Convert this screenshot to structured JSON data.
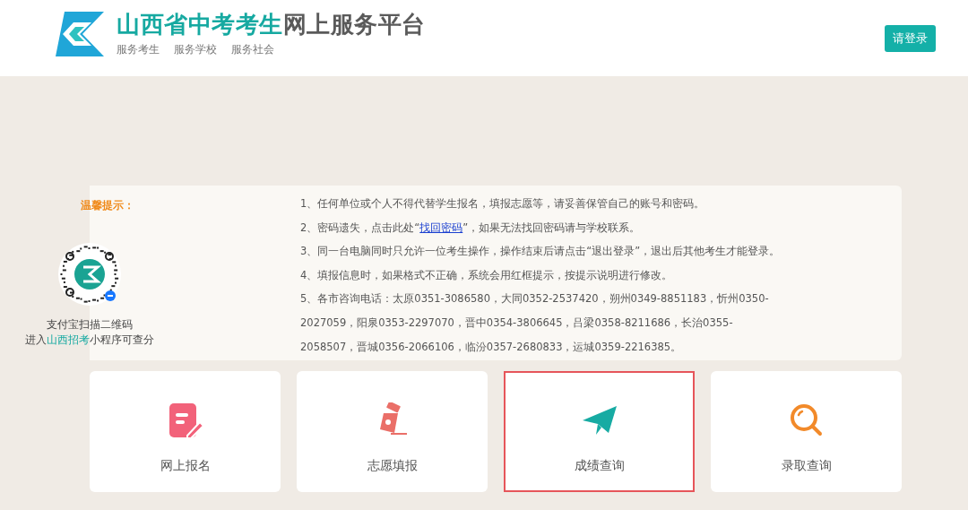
{
  "header": {
    "title_highlight": "山西省中考考生",
    "title_rest": "网上服务平台",
    "subtitle_links": [
      "服务考生",
      "服务学校",
      "服务社会"
    ],
    "login_button": "请登录"
  },
  "notice": {
    "heading": "温馨提示：",
    "qr_caption_line1": "支付宝扫描二维码",
    "qr_caption_line2": {
      "before": "进入",
      "highlight": "山西招考",
      "after": "小程序可查分"
    },
    "items": [
      {
        "before": "1、任何单位或个人不得代替学生报名，填报志愿等，请妥善保管自己的账号和密码。"
      },
      {
        "before": "2、密码遗失，点击此处“",
        "link": "找回密码",
        "after": "”，如果无法找回密码请与学校联系。"
      },
      {
        "before": "3、同一台电脑同时只允许一位考生操作，操作结束后请点击“退出登录”，退出后其他考生才能登录。"
      },
      {
        "before": "4、填报信息时，如果格式不正确，系统会用红框提示，按提示说明进行修改。"
      },
      {
        "before": "5、各市咨询电话：太原0351-3086580，大同0352-2537420，朔州0349-8851183，忻州0350-2027059，阳泉0353-2297070，晋中0354-3806645，吕梁0358-8211686，长治0355-2058507，晋城0356-2066106，临汾0357-2680833，运城0359-2216385。"
      }
    ]
  },
  "cards": [
    {
      "kind": "register",
      "label": "网上报名",
      "selected": false
    },
    {
      "kind": "pen",
      "label": "志愿填报",
      "selected": false
    },
    {
      "kind": "plane",
      "label": "成绩查询",
      "selected": true
    },
    {
      "kind": "search",
      "label": "录取查询",
      "selected": false
    }
  ]
}
